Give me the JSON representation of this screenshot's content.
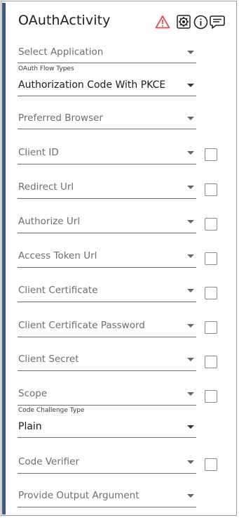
{
  "activity": {
    "title": "OAuthActivity"
  },
  "header_icons": [
    "warning-icon",
    "settings-icon",
    "info-icon",
    "comment-icon"
  ],
  "colors": {
    "accent_bar": "#3e5a86",
    "warning": "#e05050",
    "underline": "#6e6e6e",
    "placeholder_text": "#6e6e6e"
  },
  "fields": {
    "select_application": {
      "placeholder": "Select Application"
    },
    "oauth_flow_types": {
      "caption": "OAuth Flow Types",
      "value": "Authorization Code With PKCE"
    },
    "preferred_browser": {
      "placeholder": "Preferred Browser"
    },
    "client_id": {
      "placeholder": "Client ID",
      "checked": false
    },
    "redirect_url": {
      "placeholder": "Redirect Url",
      "checked": false
    },
    "authorize_url": {
      "placeholder": "Authorize Url",
      "checked": false
    },
    "access_token_url": {
      "placeholder": "Access Token Url",
      "checked": false
    },
    "client_certificate": {
      "placeholder": "Client Certificate",
      "checked": false
    },
    "client_certificate_password": {
      "placeholder": "Client Certificate Password",
      "checked": false
    },
    "client_secret": {
      "placeholder": "Client Secret",
      "checked": false
    },
    "scope": {
      "placeholder": "Scope",
      "checked": false
    },
    "code_challenge_type": {
      "caption": "Code Challenge Type",
      "value": "Plain"
    },
    "code_verifier": {
      "placeholder": "Code Verifier",
      "checked": false
    },
    "provide_output_argument": {
      "placeholder": "Provide Output Argument"
    }
  }
}
